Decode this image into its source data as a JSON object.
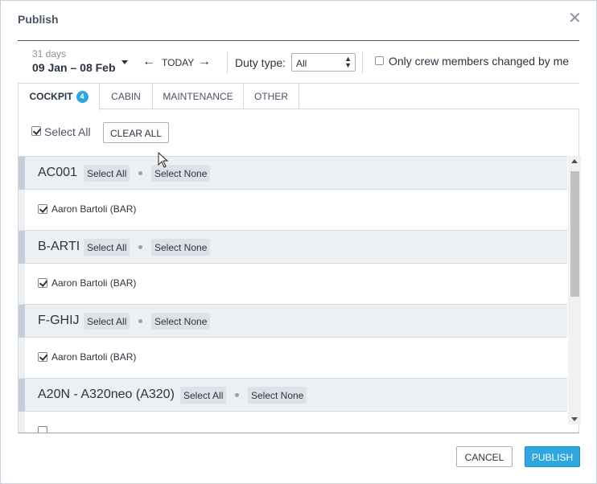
{
  "dialog": {
    "title": "Publish",
    "close_label": "✕"
  },
  "toolbar": {
    "days": "31 days",
    "date_range": "09 Jan – 08 Feb",
    "prev": "←",
    "today": "TODAY",
    "next": "→",
    "duty_label": "Duty type:",
    "duty_value": "All",
    "only_changed_label": "Only crew members changed by me"
  },
  "tabs": [
    {
      "label": "COCKPIT",
      "badge": "4"
    },
    {
      "label": "CABIN"
    },
    {
      "label": "MAINTENANCE"
    },
    {
      "label": "OTHER"
    }
  ],
  "panel": {
    "select_all_label": "Select All",
    "clear_all_label": "CLEAR ALL"
  },
  "groups": [
    {
      "name": "AC001",
      "select_all": "Select All",
      "select_none": "Select None",
      "members": [
        "Aaron Bartoli (BAR)"
      ]
    },
    {
      "name": "B-ARTI",
      "select_all": "Select All",
      "select_none": "Select None",
      "members": [
        "Aaron Bartoli (BAR)"
      ]
    },
    {
      "name": "F-GHIJ",
      "select_all": "Select All",
      "select_none": "Select None",
      "members": [
        "Aaron Bartoli (BAR)"
      ]
    },
    {
      "name": "A20N - A320neo (A320)",
      "select_all": "Select All",
      "select_none": "Select None",
      "members": [
        ""
      ]
    }
  ],
  "footer": {
    "cancel_label": "CANCEL",
    "publish_label": "PUBLISH"
  },
  "colors": {
    "accent": "#2fa6de",
    "group_bg": "#edf0f3",
    "text": "#2b3440"
  },
  "icons": {
    "close": "close-icon",
    "date_caret": "chevron-down-icon",
    "prev": "arrow-left-icon",
    "next": "arrow-right-icon",
    "cursor": "mouse-pointer-icon"
  }
}
